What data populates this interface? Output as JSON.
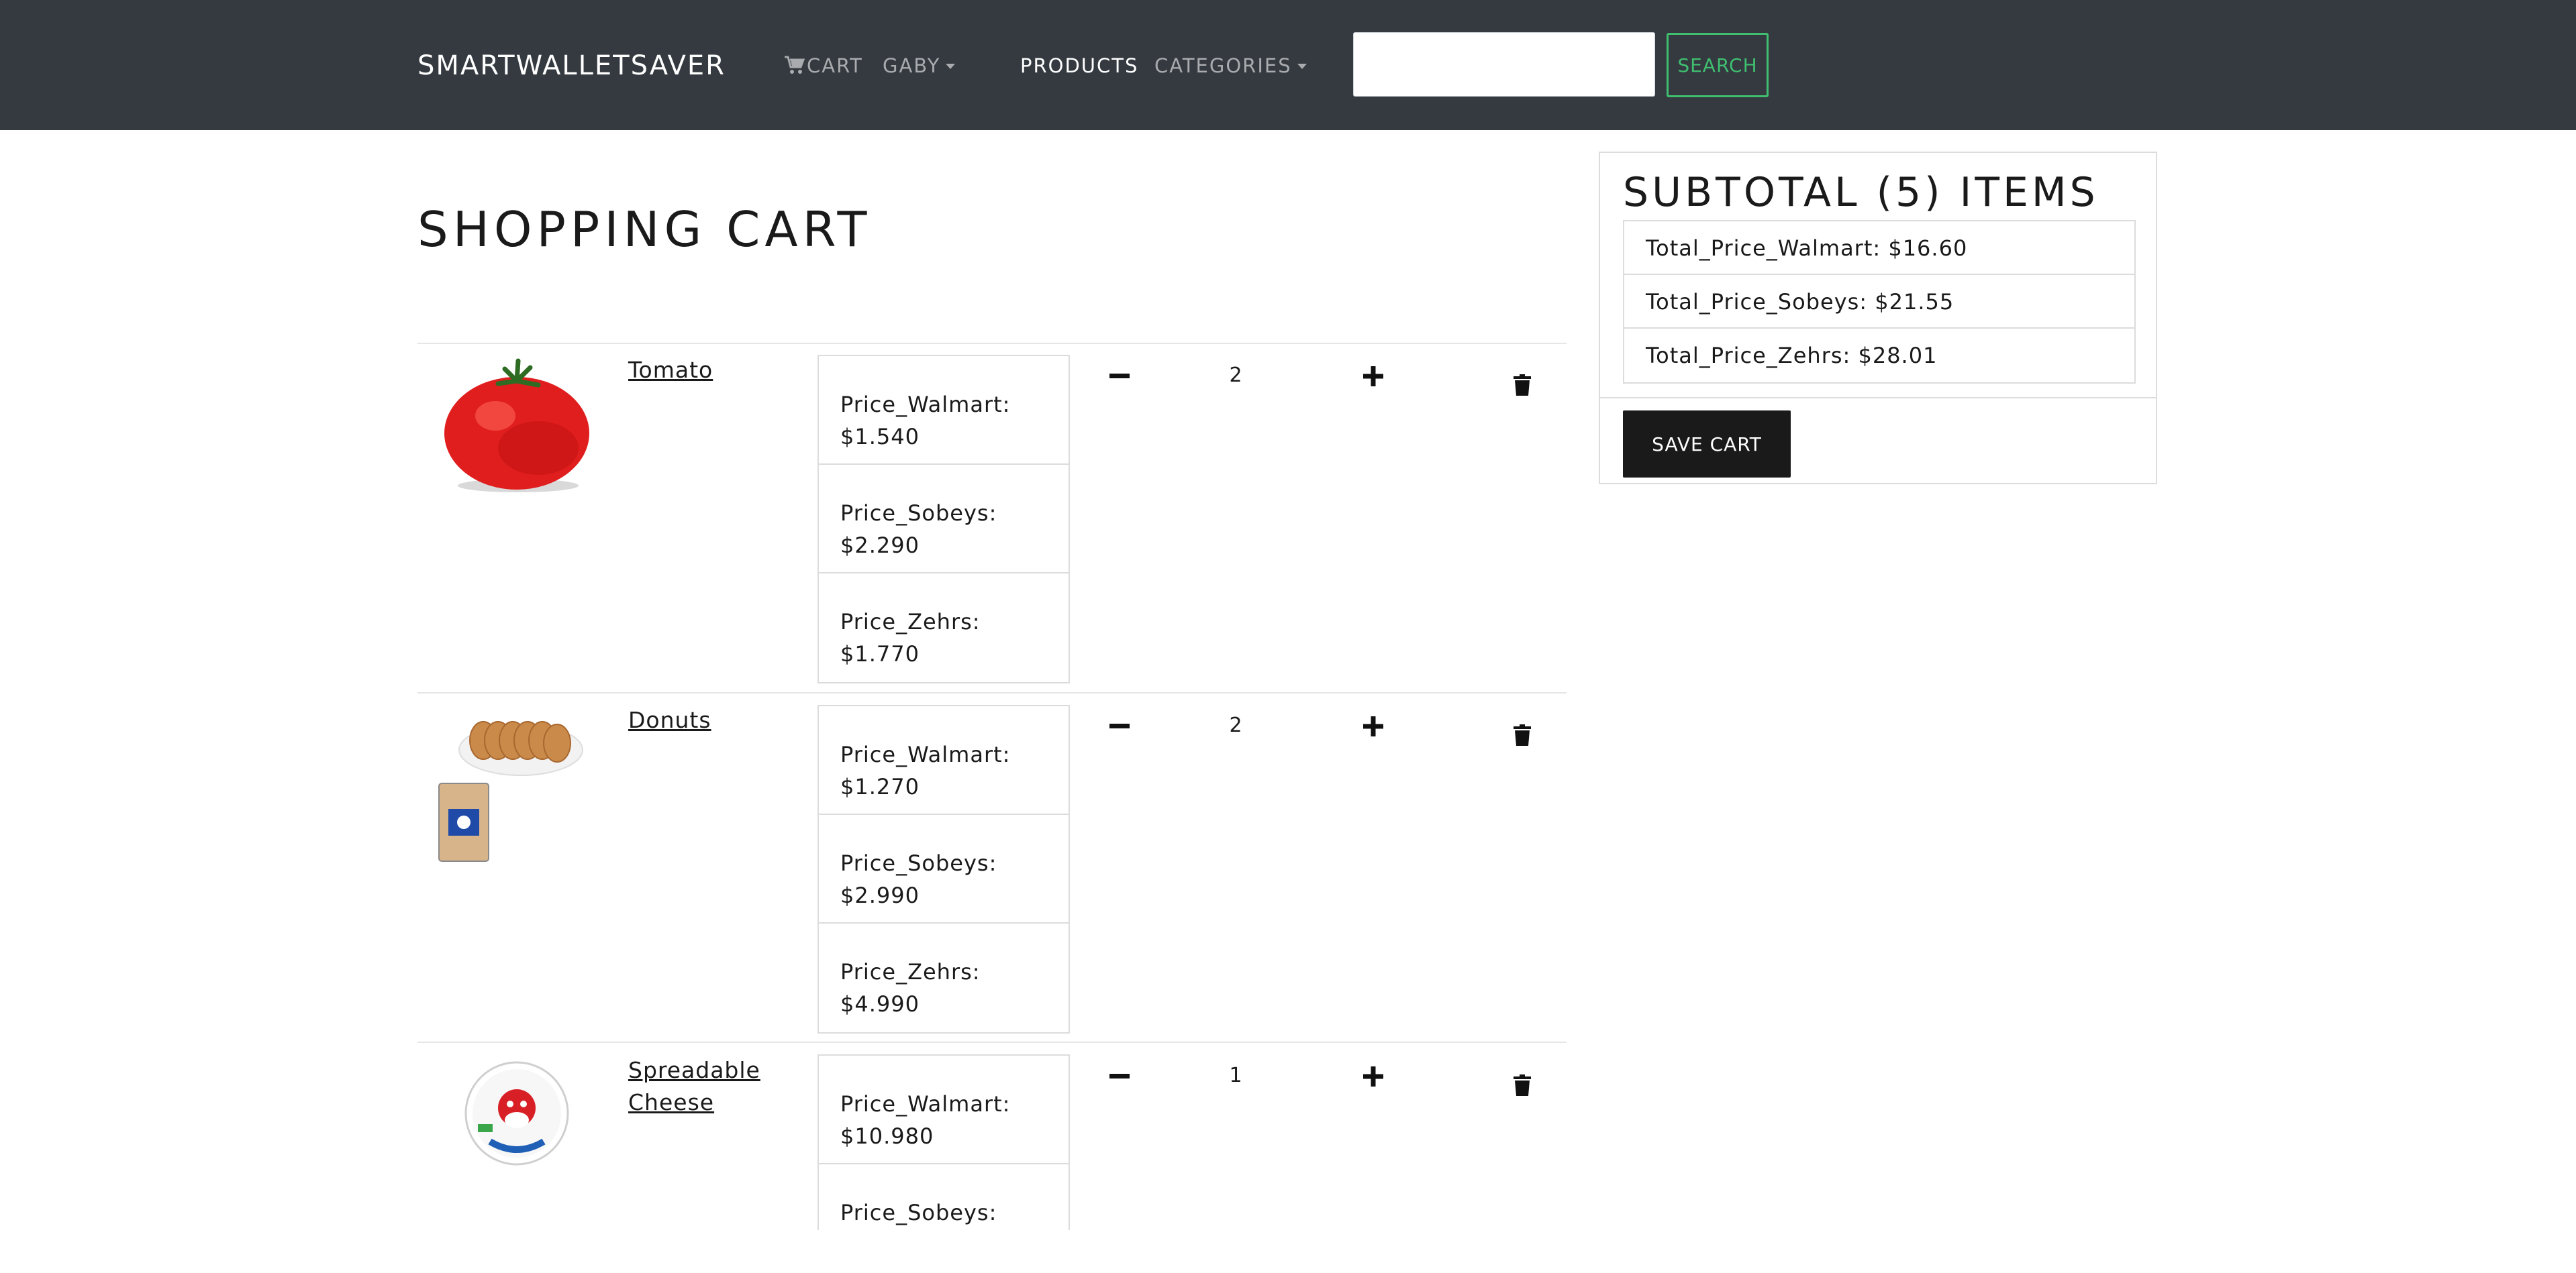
{
  "navbar": {
    "brand": "SMARTWALLETSAVER",
    "cart_label": "CART",
    "user_label": "GABY",
    "products_label": "PRODUCTS",
    "categories_label": "CATEGORIES",
    "search_placeholder": "",
    "search_value": "",
    "search_button": "SEARCH"
  },
  "page": {
    "title": "SHOPPING CART"
  },
  "cart": {
    "items": [
      {
        "name": "Tomato",
        "prices": [
          "Price_Walmart: $1.540",
          "Price_Sobeys: $2.290",
          "Price_Zehrs: $1.770"
        ],
        "quantity": "2"
      },
      {
        "name": "Donuts",
        "prices": [
          "Price_Walmart: $1.270",
          "Price_Sobeys: $2.990",
          "Price_Zehrs: $4.990"
        ],
        "quantity": "2"
      },
      {
        "name": "Spreadable Cheese",
        "prices": [
          "Price_Walmart: $10.980",
          "Price_Sobeys:"
        ],
        "quantity": "1"
      }
    ]
  },
  "subtotal": {
    "title": "SUBTOTAL (5) ITEMS",
    "totals": [
      "Total_Price_Walmart: $16.60",
      "Total_Price_Sobeys: $21.55",
      "Total_Price_Zehrs: $28.01"
    ],
    "save_button": "SAVE CART"
  },
  "colors": {
    "navbar_bg": "#343a40",
    "search_accent": "#3fbf6f",
    "save_button_bg": "#1a1a1a"
  }
}
